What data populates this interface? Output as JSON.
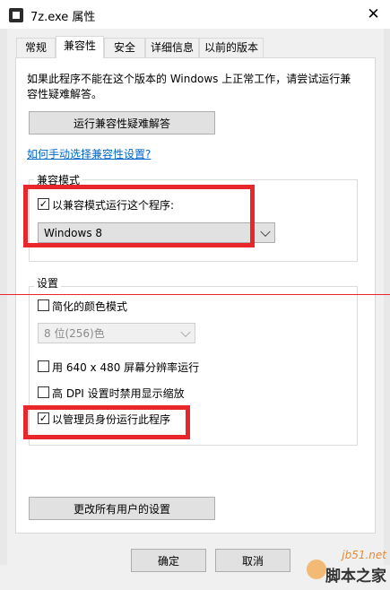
{
  "window": {
    "title": "7z.exe 属性",
    "close_glyph": "✕"
  },
  "tabs": [
    {
      "label": "常规"
    },
    {
      "label": "兼容性"
    },
    {
      "label": "安全"
    },
    {
      "label": "详细信息"
    },
    {
      "label": "以前的版本"
    }
  ],
  "compat": {
    "intro": "如果此程序不能在这个版本的 Windows 上正常工作，请尝试运行兼容性疑难解答。",
    "troubleshoot_button": "运行兼容性疑难解答",
    "manual_link": "如何手动选择兼容性设置?",
    "mode_group_label": "兼容模式",
    "mode_checkbox_label": "以兼容模式运行这个程序:",
    "mode_checked": true,
    "os_selected": "Windows 8",
    "settings_group_label": "设置",
    "reduced_color_label": "简化的颜色模式",
    "reduced_color_checked": false,
    "color_selected": "8 位(256)色",
    "resolution_label": "用 640 x 480 屏幕分辨率运行",
    "resolution_checked": false,
    "dpi_label": "高 DPI 设置时禁用显示缩放",
    "dpi_checked": false,
    "admin_label": "以管理员身份运行此程序",
    "admin_checked": true,
    "all_users_button": "更改所有用户的设置"
  },
  "footer": {
    "ok_button": "确定",
    "cancel_button": "取消"
  },
  "watermark": {
    "url": "jb51.net",
    "name": "脚本之家"
  },
  "colors": {
    "annotation_red": "#e8272c",
    "link_blue": "#0066cc"
  }
}
